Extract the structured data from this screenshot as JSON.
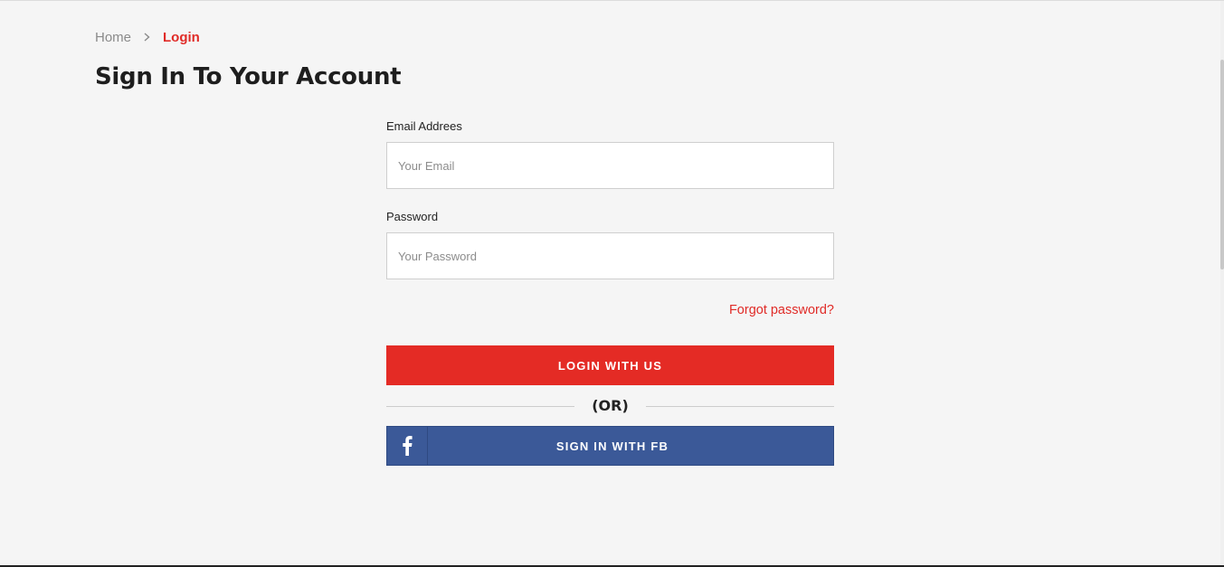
{
  "breadcrumb": {
    "home": "Home",
    "current": "Login"
  },
  "page": {
    "title": "Sign In To Your Account"
  },
  "form": {
    "email_label": "Email Addrees",
    "email_placeholder": "Your Email",
    "password_label": "Password",
    "password_placeholder": "Your Password",
    "forgot_link": "Forgot password?",
    "login_button": "LOGIN WITH US",
    "or_text": "(OR)",
    "fb_button": "SIGN IN WITH FB",
    "fb_icon": "facebook-icon"
  },
  "colors": {
    "accent": "#e42b25",
    "facebook": "#3b5998",
    "background": "#f5f5f5"
  }
}
